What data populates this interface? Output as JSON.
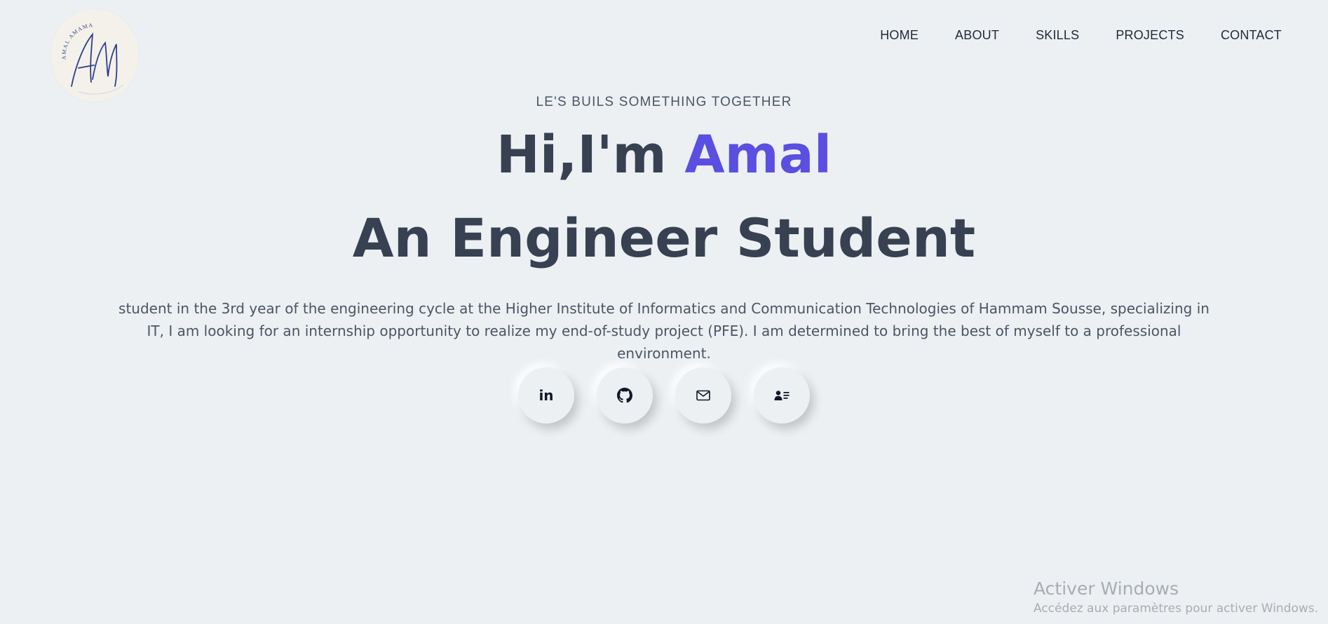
{
  "logo": {
    "monogram": "AM",
    "ring_text": "AMAL AMAMA",
    "ink_color": "#2c3e8f"
  },
  "nav": {
    "items": [
      {
        "label": "HOME"
      },
      {
        "label": "ABOUT"
      },
      {
        "label": "SKILLS"
      },
      {
        "label": "PROJECTS"
      },
      {
        "label": "CONTACT"
      }
    ]
  },
  "hero": {
    "tagline": "LE'S BUILS SOMETHING TOGETHER",
    "greeting_prefix": "Hi,I'm ",
    "greeting_name": "Amal",
    "role": "An Engineer Student",
    "description": "student in the 3rd year of the engineering cycle at the Higher Institute of Informatics and Communication Technologies of Hammam Sousse, specializing in IT, I am looking for an internship opportunity to realize my end-of-study project (PFE). I am determined to bring the best of myself to a professional environment."
  },
  "socials": [
    {
      "name": "linkedin-icon",
      "glyph": "in"
    },
    {
      "name": "github-icon"
    },
    {
      "name": "mail-icon"
    },
    {
      "name": "contact-card-icon"
    }
  ],
  "watermark": {
    "title": "Activer Windows",
    "subtitle": "Accédez aux paramètres pour activer Windows."
  },
  "colors": {
    "background": "#ecf0f3",
    "text": "#374151",
    "accent": "#5a4fe0"
  }
}
